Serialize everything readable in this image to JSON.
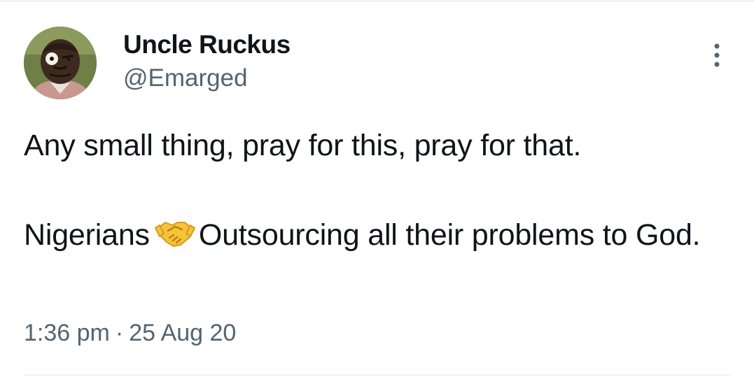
{
  "author": {
    "display_name": "Uncle Ruckus",
    "handle": "@Emarged",
    "avatar_icon": "cartoon-avatar"
  },
  "menu": {
    "icon": "more-vertical-icon"
  },
  "tweet": {
    "line1": "Any small thing, pray for this, pray for that.",
    "line2_before_emoji": "Nigerians",
    "emoji": "handshake-icon",
    "line2_after_emoji": "Outsourcing all their problems to God."
  },
  "meta": {
    "time": "1:36 pm",
    "separator": "·",
    "date": "25 Aug 20"
  },
  "colors": {
    "text_primary": "#0f1419",
    "text_secondary": "#536471",
    "divider": "#eff3f4",
    "emoji_yellow": "#f5c43b"
  }
}
